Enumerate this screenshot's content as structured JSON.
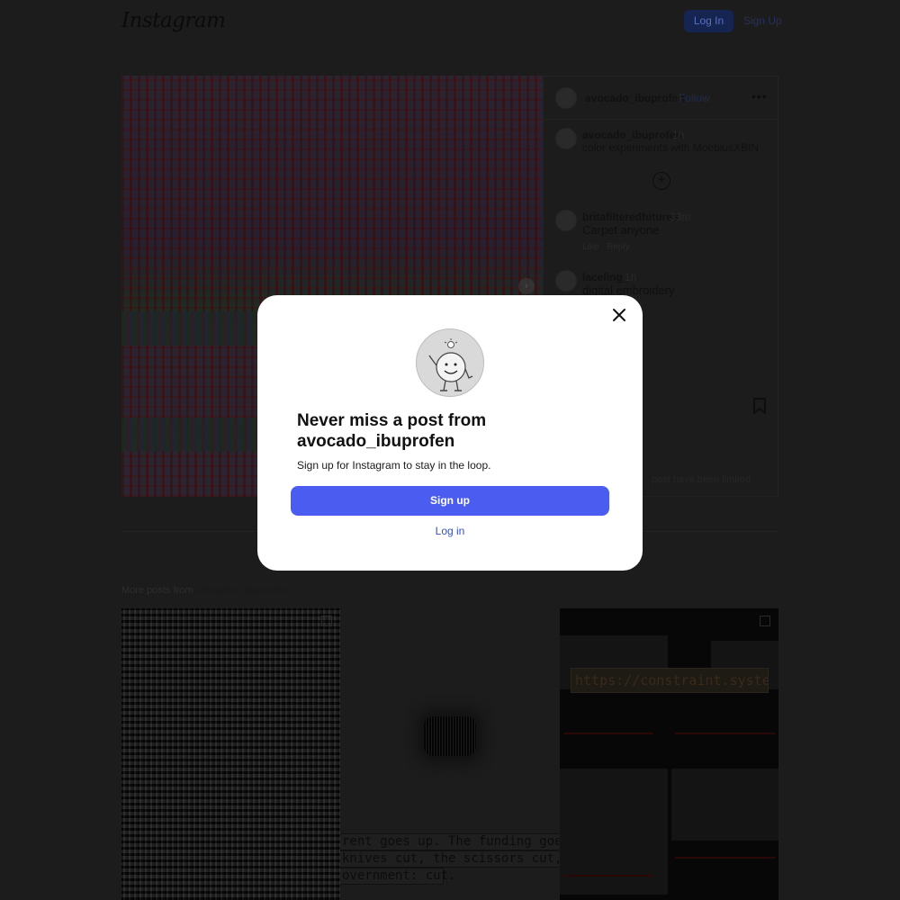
{
  "header": {
    "logo": "Instagram",
    "login_label": "Log In",
    "signup_label": "Sign Up"
  },
  "post": {
    "author": "avocado_ibuprofen",
    "follow_label": "Follow",
    "separator": "·",
    "more_icon": "more-horizontal-icon",
    "caption": {
      "username": "avocado_ibuprofen",
      "time": "1h",
      "text": "color experiments with MoebiusXBIN"
    },
    "comments": [
      {
        "username": "britafilteredfutures",
        "time": "33m",
        "text": "Carpet anyone",
        "like_label": "Like",
        "reply_label": "Reply"
      },
      {
        "username": "laceling_",
        "time": "1h",
        "text": "digital embroidery"
      }
    ],
    "comments_note": "post have been limited."
  },
  "more_posts": {
    "prefix": "More posts from",
    "username": "avocado_ibuprofen",
    "thumbs": [
      {
        "kind": "ascii-art"
      },
      {
        "kind": "text-art",
        "lines": [
          "rent goes up. The funding goes dow",
          "knives cut, the scissors cut, the vo",
          "overnment: cut."
        ]
      },
      {
        "kind": "collage",
        "url": "https://constraint.systems"
      }
    ]
  },
  "modal": {
    "title": "Never miss a post from avocado_ibuprofen",
    "subtitle": "Sign up for Instagram to stay in the loop.",
    "signup_label": "Sign up",
    "login_label": "Log in"
  },
  "colors": {
    "accent": "#4a5df0",
    "link": "#3850c4",
    "overlay": "#1c1c1c"
  }
}
